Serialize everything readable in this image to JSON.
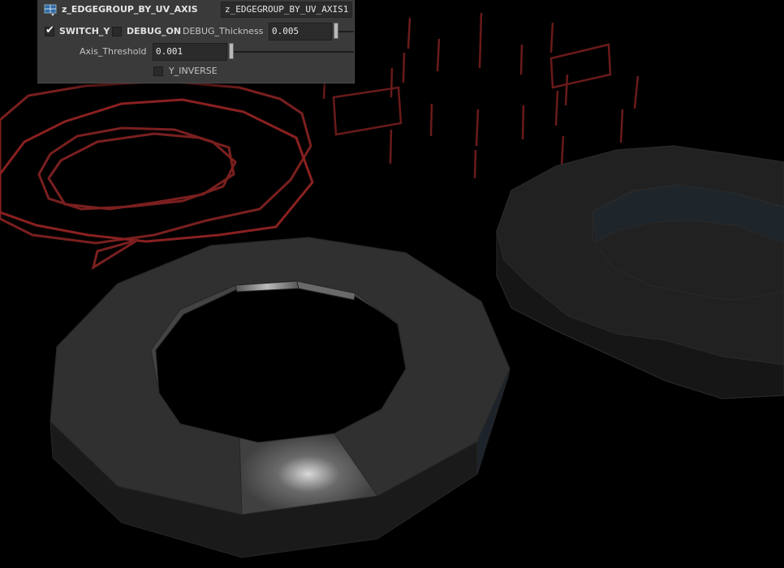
{
  "node": {
    "type_label": "z_EDGEGROUP_BY_UV_AXIS",
    "name": "z_EDGEGROUP_BY_UV_AXIS1"
  },
  "params": {
    "switch_y": {
      "label": "SWITCH_Y",
      "checked": true
    },
    "debug_on": {
      "label": "DEBUG_ON",
      "checked": false
    },
    "debug_thickness": {
      "label": "DEBUG_Thickness",
      "value": "0.005"
    },
    "axis_threshold": {
      "label": "Axis_Threshold",
      "value": "0.001"
    },
    "y_inverse": {
      "label": "Y_INVERSE",
      "checked": false
    }
  },
  "colors": {
    "panel_bg": "#3a3a3a",
    "debug_wire": "#7a1f1f",
    "mesh_light": "#3a3a3a",
    "mesh_dark": "#1c1c1c"
  }
}
